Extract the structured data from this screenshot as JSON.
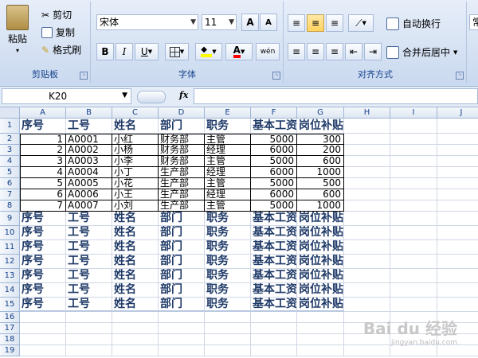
{
  "ribbon": {
    "clipboard": {
      "paste": "粘贴",
      "cut": "剪切",
      "copy": "复制",
      "format_painter": "格式刷",
      "label": "剪贴板"
    },
    "font": {
      "name": "宋体",
      "size": "11",
      "grow": "A",
      "shrink": "A",
      "bold": "B",
      "italic": "I",
      "underline": "U",
      "phonetic": "wén",
      "label": "字体",
      "fill_color": "#ffff00",
      "font_color": "#ff0000"
    },
    "alignment": {
      "wrap": "自动换行",
      "merge": "合并后居中",
      "label": "对齐方式"
    },
    "number": {
      "format": "常"
    }
  },
  "formula_bar": {
    "name_box": "K20",
    "fx": "fx",
    "content": ""
  },
  "columns": [
    "A",
    "B",
    "C",
    "D",
    "E",
    "F",
    "G",
    "H",
    "I",
    "J"
  ],
  "rows": [
    "1",
    "2",
    "3",
    "4",
    "5",
    "6",
    "7",
    "8",
    "9",
    "10",
    "11",
    "12",
    "13",
    "14",
    "15",
    "16",
    "17",
    "18",
    "19"
  ],
  "headers": [
    "序号",
    "工号",
    "姓名",
    "部门",
    "职务",
    "基本工资",
    "岗位补贴"
  ],
  "employees": [
    [
      "1",
      "A0001",
      "小红",
      "财务部",
      "主管",
      "5000",
      "300"
    ],
    [
      "2",
      "A0002",
      "小杨",
      "财务部",
      "经理",
      "6000",
      "200"
    ],
    [
      "3",
      "A0003",
      "小李",
      "财务部",
      "主管",
      "5000",
      "600"
    ],
    [
      "4",
      "A0004",
      "小丁",
      "生产部",
      "经理",
      "6000",
      "1000"
    ],
    [
      "5",
      "A0005",
      "小花",
      "生产部",
      "主管",
      "5000",
      "500"
    ],
    [
      "6",
      "A0006",
      "小王",
      "生产部",
      "经理",
      "6000",
      "600"
    ],
    [
      "7",
      "A0007",
      "小刘",
      "生产部",
      "主管",
      "5000",
      "1000"
    ]
  ],
  "watermark": {
    "main": "Bai du 经验",
    "sub": "jingyan.baidu.com"
  }
}
